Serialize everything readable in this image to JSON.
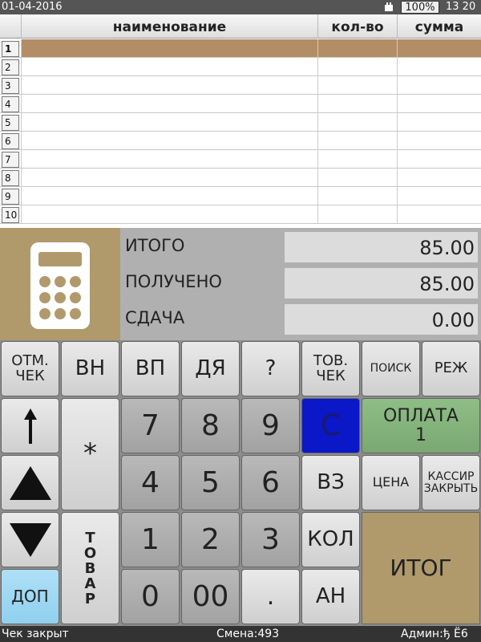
{
  "status": {
    "date": "01-04-2016",
    "battery": "100%",
    "time": "13 20"
  },
  "table": {
    "headers": {
      "num": "",
      "name": "наименование",
      "qty": "кол-во",
      "sum": "сумма"
    },
    "rows": [
      "1",
      "2",
      "3",
      "4",
      "5",
      "6",
      "7",
      "8",
      "9",
      "10"
    ],
    "selected_row": "1"
  },
  "totals": {
    "itogo_label": "ИТОГО",
    "itogo_value": "85.00",
    "received_label": "ПОЛУЧЕНО",
    "received_value": "85.00",
    "change_label": "СДАЧА",
    "change_value": "0.00"
  },
  "keys": {
    "otm_chek": "ОТМ. ЧЕК",
    "vn": "ВН",
    "vp": "ВП",
    "dya": "ДЯ",
    "question": "?",
    "tov_chek": "ТОВ. ЧЕК",
    "poisk": "ПОИСК",
    "rezh": "РЕЖ",
    "star": "*",
    "d7": "7",
    "d8": "8",
    "d9": "9",
    "d4": "4",
    "d5": "5",
    "d6": "6",
    "d1": "1",
    "d2": "2",
    "d3": "3",
    "d0": "0",
    "d00": "00",
    "dot": ".",
    "c": "С",
    "oplata": "ОПЛАТА 1",
    "vz": "ВЗ",
    "cena": "ЦЕНА",
    "kassir": "КАССИР ЗАКРЫТЬ",
    "kol": "КОЛ",
    "an": "АН",
    "itog": "ИТОГ",
    "dop": "ДОП",
    "tovar": "ТОВАР"
  },
  "bottom": {
    "check_status": "Чек закрыт",
    "shift": "Смена:493",
    "admin": "Админ:ђ Ё6"
  },
  "colors": {
    "accent_tan": "#b09a6c",
    "selected_row": "#b38d66",
    "key_c_blue": "#0a18c8",
    "key_payment_green": "#8ebe86",
    "key_dop_blue": "#aee0f7"
  }
}
